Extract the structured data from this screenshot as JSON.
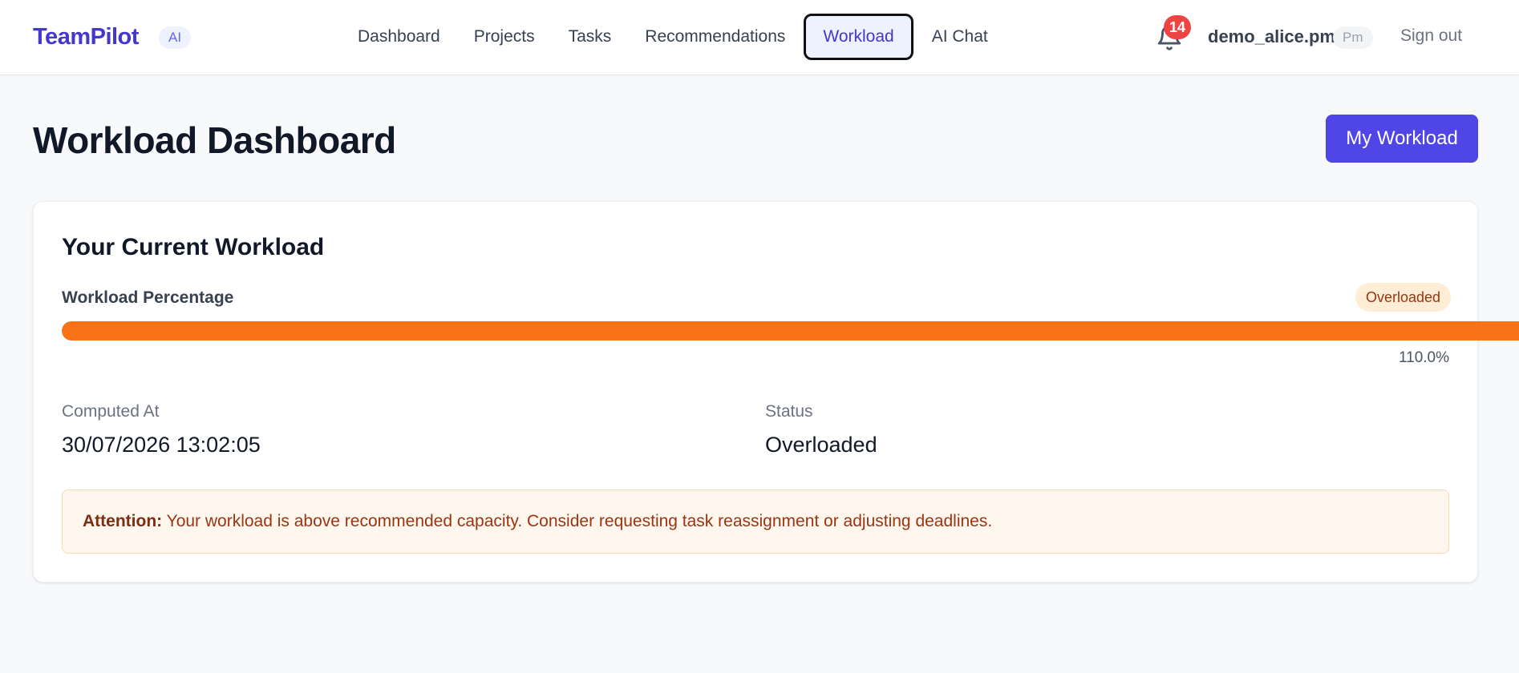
{
  "header": {
    "brand": "TeamPilot",
    "brand_badge": "AI",
    "nav": [
      {
        "label": "Dashboard",
        "active": false
      },
      {
        "label": "Projects",
        "active": false
      },
      {
        "label": "Tasks",
        "active": false
      },
      {
        "label": "Recommendations",
        "active": false
      },
      {
        "label": "Workload",
        "active": true
      },
      {
        "label": "AI Chat",
        "active": false
      }
    ],
    "notification_icon": "bell-icon",
    "notification_count": "14",
    "username": "demo_alice.pm",
    "role": "Pm",
    "sign_out": "Sign out"
  },
  "page": {
    "title": "Workload Dashboard",
    "primary_button": "My Workload"
  },
  "workload": {
    "card_title": "Your Current Workload",
    "percentage_label": "Workload Percentage",
    "state_badge": "Overloaded",
    "percentage": 110.0,
    "percentage_text": "110.0%",
    "computed_at_label": "Computed At",
    "computed_at": "30/07/2026 13:02:05",
    "status_label": "Status",
    "status": "Overloaded",
    "alert_title": "Attention:",
    "alert_message": "Your workload is above recommended capacity. Consider requesting task reassignment or adjusting deadlines."
  },
  "colors": {
    "brand": "#4338ca",
    "primary": "#4f46e5",
    "progress": "#f97316",
    "badge_danger": "#ef4444",
    "alert_bg": "#fff7ed"
  }
}
